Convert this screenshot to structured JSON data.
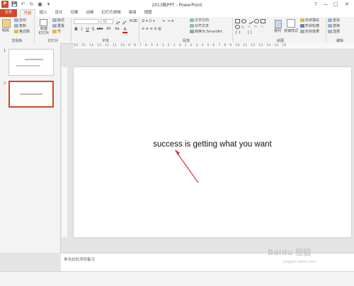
{
  "window": {
    "title": "2013版PPT - PowerPoint",
    "logo": "P",
    "min": "—",
    "max": "□",
    "close": "✕",
    "help": "?"
  },
  "tabs": [
    "文件",
    "开始",
    "插入",
    "设计",
    "切换",
    "动画",
    "幻灯片放映",
    "审阅",
    "视图"
  ],
  "ribbon": {
    "clipboard": {
      "paste": "粘贴",
      "cut": "剪切",
      "copy": "复制",
      "format_painter": "格式刷",
      "label": "剪贴板"
    },
    "slides": {
      "new_slide": "新建\n幻灯片",
      "layout": "版式",
      "reset": "重置",
      "section": "节",
      "label": "幻灯片"
    },
    "font": {
      "font_name": "",
      "font_size": "32",
      "bold": "B",
      "italic": "I",
      "underline": "U",
      "strike": "S",
      "shadow": "abc",
      "spacing": "AV",
      "case": "Aa",
      "color": "A",
      "label": "字体"
    },
    "paragraph": {
      "text_direction": "文字方向",
      "align_text": "对齐文本",
      "smartart": "转换为 SmartArt",
      "label": "段落"
    },
    "drawing": {
      "arrange": "排列",
      "quick_styles": "快速样式",
      "fill": "形状填充",
      "outline": "形状轮廓",
      "effects": "形状效果",
      "label": "绘图"
    },
    "editing": {
      "find": "查找",
      "replace": "替换",
      "select": "选择",
      "label": "编辑"
    }
  },
  "ruler": {
    "text": "16 · 15 · 14 · 13 · 12 · 11 · 10 · 9 · 8 · 7 · 6 · 5 · 4 · 3 · 2 · 1 · 0 · 1 · 2 · 3 · 4 · 5 · 6 · 7 · 8 · 9 · 10 · 11 · 12 · 13 · 14 · 15 · 16"
  },
  "thumbnails": [
    {
      "number": "1"
    },
    {
      "number": "2"
    }
  ],
  "slide": {
    "text": "success is getting what you want"
  },
  "notes": {
    "placeholder": "单击此处添加备注"
  },
  "watermark": {
    "text": "Baidu 经验",
    "sub": "jingyan.baidu.com"
  },
  "colors": {
    "accent": "#d24726",
    "arrow": "#e0303a"
  }
}
